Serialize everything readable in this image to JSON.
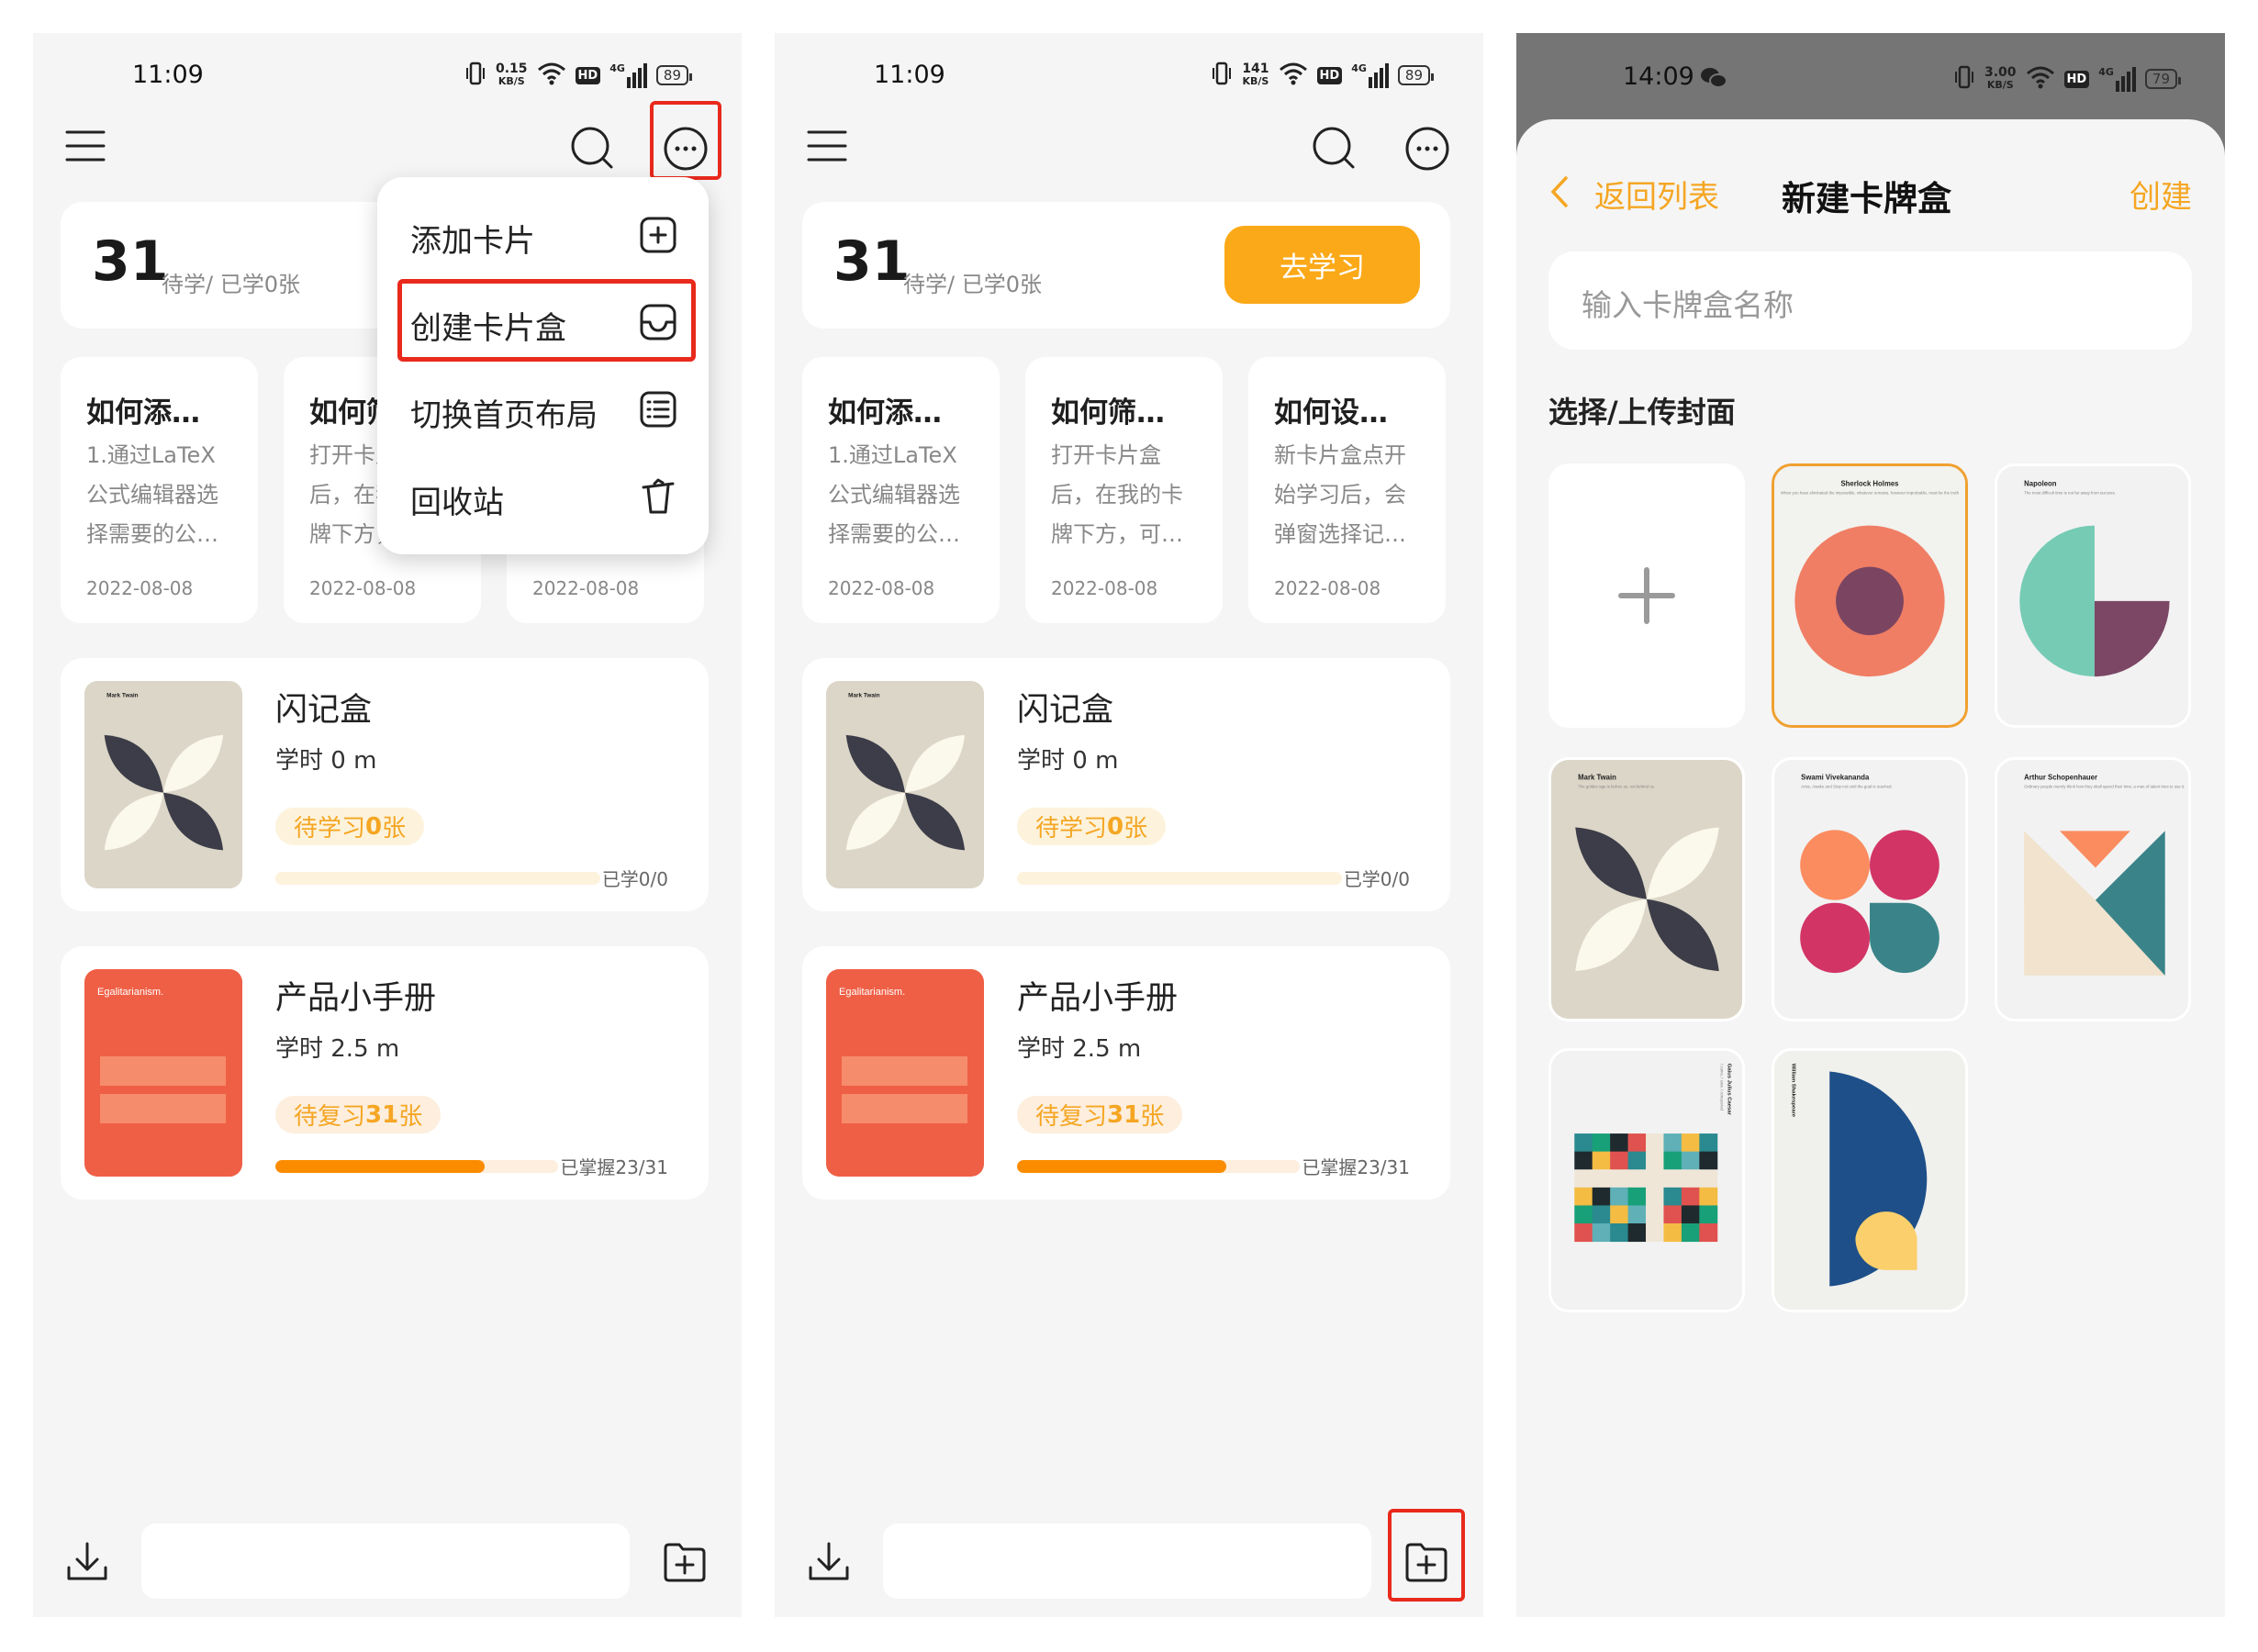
{
  "status_bars": {
    "left": {
      "time": "11:09",
      "net_speed": "0.15",
      "net_unit": "KB/S",
      "hd": "HD",
      "network": "4G",
      "battery": "89"
    },
    "middle": {
      "time": "11:09",
      "net_speed": "141",
      "net_unit": "KB/S",
      "hd": "HD",
      "network": "4G",
      "battery": "89"
    },
    "right": {
      "time": "14:09",
      "net_speed": "3.00",
      "net_unit": "KB/S",
      "hd": "HD",
      "network": "4G",
      "battery": "79"
    }
  },
  "home": {
    "summary": {
      "count": "31",
      "label": "待学/ 已学0张",
      "study_button": "去学习"
    },
    "tips": [
      {
        "title": "如何添…",
        "lines": [
          "1.通过LaTeX",
          "公式编辑器选",
          "择需要的公…"
        ],
        "date": "2022-08-08"
      },
      {
        "title": "如何筛…",
        "lines": [
          "打开卡片盒",
          "后，在我的卡",
          "牌下方，可…"
        ],
        "date": "2022-08-08"
      },
      {
        "title": "如何设…",
        "lines": [
          "新卡片盒点开",
          "始学习后，会",
          "弹窗选择记…"
        ],
        "date": "2022-08-08"
      }
    ],
    "decks": [
      {
        "name": "闪记盒",
        "time": "学时 0 m",
        "badge_label": "待学习",
        "badge_count": "0",
        "badge_unit": "张",
        "progress": 0,
        "progress_label": "已学0/0",
        "cover": "mark-twain",
        "cover_title": "Mark Twain",
        "badge_bg": "#fdf3dc",
        "track_bg": "#fdf3dc"
      },
      {
        "name": "产品小手册",
        "time": "学时 2.5 m",
        "badge_label": "待复习",
        "badge_count": "31",
        "badge_unit": "张",
        "progress": 0.74,
        "progress_label": "已掌握23/31",
        "cover": "egalitarianism",
        "cover_title": "Egalitarianism.",
        "badge_bg": "#fdeedd",
        "track_bg": "#fdeedd"
      }
    ]
  },
  "menu": {
    "items": [
      {
        "label": "添加卡片",
        "icon": "plus-square-icon"
      },
      {
        "label": "创建卡片盒",
        "icon": "inbox-icon"
      },
      {
        "label": "切换首页布局",
        "icon": "list-icon"
      },
      {
        "label": "回收站",
        "icon": "trash-icon"
      }
    ]
  },
  "create": {
    "back_label": "返回列表",
    "title": "新建卡牌盒",
    "create_label": "创建",
    "name_placeholder": "输入卡牌盒名称",
    "cover_section": "选择/上传封面",
    "covers": [
      {
        "art": "sherlock",
        "title": "Sherlock Holmes",
        "quote": "When you have eliminated the impossible, whatever remains, however improbable, must be the truth",
        "selected": true
      },
      {
        "art": "napoleon",
        "title": "Napoleon",
        "quote": "The most difficult time is not far away from success."
      },
      {
        "art": "mark-twain",
        "title": "Mark Twain",
        "quote": "The golden age is before us, not behind us."
      },
      {
        "art": "swami",
        "title": "Swami Vivekananda",
        "quote": "Arise, Awake and Stop not until the goal is reached."
      },
      {
        "art": "schopenhauer",
        "title": "Arthur Schopenhauer",
        "quote": "Ordinary people merely think how they shall spend their time; a man of talent tries to use it."
      },
      {
        "art": "caesar",
        "title": "Gaius Julius Caesar",
        "quote": "I came, I saw, I conquered"
      },
      {
        "art": "shakespeare",
        "title": "William Shakespeare"
      }
    ]
  },
  "colors": {
    "accent": "#f5a623",
    "study_button": "#fba918",
    "progress_fill": "#fb8c00",
    "highlight": "#e8291c",
    "dim_status": "#757575"
  }
}
